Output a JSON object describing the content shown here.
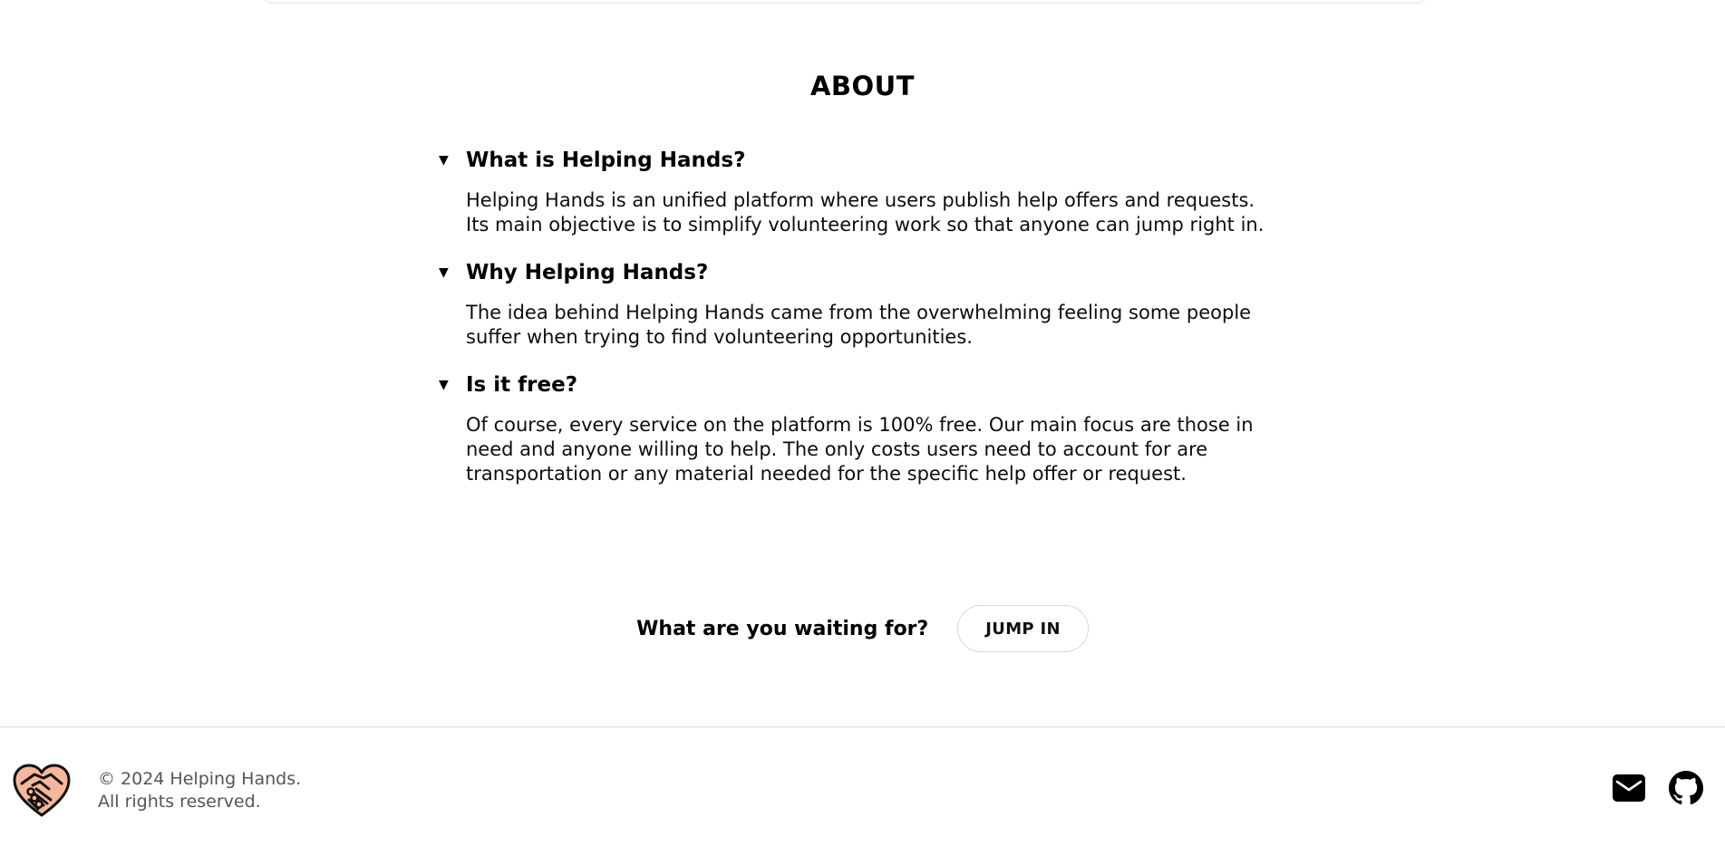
{
  "about": {
    "title": "ABOUT",
    "items": [
      {
        "toggle": "▼",
        "question": "What is Helping Hands?",
        "answer": "Helping Hands is an unified platform where users publish help offers and requests. Its main objective is to simplify volunteering work so that anyone can jump right in."
      },
      {
        "toggle": "▼",
        "question": "Why Helping Hands?",
        "answer": "The idea behind Helping Hands came from the overwhelming feeling some people suffer when trying to find volunteering opportunities."
      },
      {
        "toggle": "▼",
        "question": "Is it free?",
        "answer": "Of course, every service on the platform is 100% free. Our main focus are those in need and anyone willing to help. The only costs users need to account for are transportation or any material needed for the specific help offer or request."
      }
    ]
  },
  "cta": {
    "text": "What are you waiting for?",
    "button_label": "JUMP IN"
  },
  "footer": {
    "logo_icon": "handshake-heart-icon",
    "copyright_line1": "© 2024 Helping Hands.",
    "copyright_line2": "All rights reserved.",
    "icons": [
      "mail-icon",
      "github-icon"
    ]
  },
  "colors": {
    "logo_fill": "#f6b79a",
    "text": "#111111",
    "muted": "#555555",
    "border": "#d9d9d9"
  }
}
